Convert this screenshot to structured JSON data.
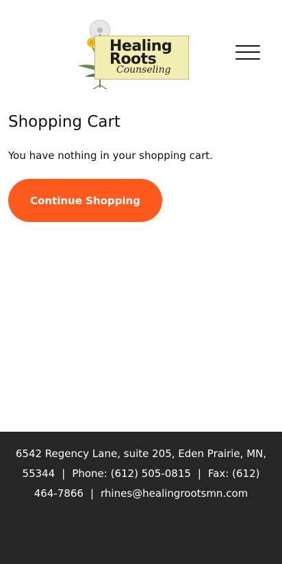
{
  "header": {
    "logo": {
      "word1": "Healing",
      "word2": "Roots",
      "word3": "Counseling"
    },
    "menu_icon": "hamburger-menu-icon"
  },
  "main": {
    "title": "Shopping Cart",
    "empty_message": "You have nothing in your shopping cart.",
    "continue_button_label": "Continue Shopping"
  },
  "footer": {
    "address": "6542 Regency Lane, suite 205, Eden Prairie, MN, 55344",
    "separator": "|",
    "phone": "Phone: (612) 505-0815",
    "fax": "Fax: (612) 464-7866",
    "email": "rhines@healingrootsmn.com"
  },
  "colors": {
    "accent": "#fe5a1d",
    "footer_bg": "#262626",
    "logo_bg": "#f3efb0"
  }
}
